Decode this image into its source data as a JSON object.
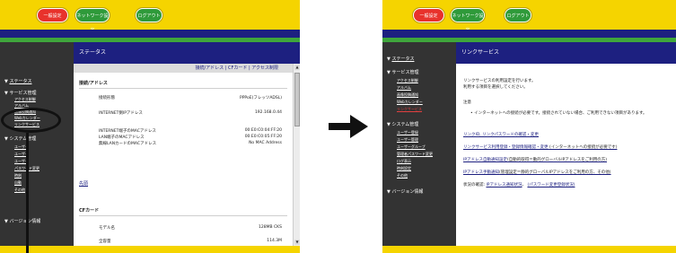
{
  "colors": {
    "header_yellow": "#f5d400",
    "nav_blue": "#1d2080",
    "accent_green": "#3fa63c",
    "sidebar_dark": "#333333",
    "button_red": "#e8322c",
    "button_green": "#2f9a3a",
    "link_blue": "#1d2080"
  },
  "left": {
    "top_buttons": [
      "一般設定",
      "ネットワーク設定",
      "ログアウト"
    ],
    "sidebar": {
      "status": "ステータス",
      "service_mgmt": "サービス管理",
      "service_items": [
        "アクセス制御",
        "アルバム",
        "画像投稿通知",
        "Webカレンダー"
      ],
      "highlighted": "リンクサービス",
      "system_mgmt": "システム管理",
      "system_items": [
        "ユーザー",
        "ユーザー",
        "ユーザー",
        "パスワード変更",
        "時刻",
        "自動",
        "その他"
      ],
      "version": "バージョン情報"
    },
    "title": "ステータス",
    "links_bar": "接続/アドレス | CFカード | アクセス制限",
    "section1": "接続/アドレス",
    "rows": [
      {
        "label": "接続形態",
        "value": "PPPoE(フレッツADSL)"
      },
      {
        "label": "INTERNET側IPアドレス",
        "value": "192.168.0.44"
      },
      {
        "label": "INTERNET端子のMACアドレス",
        "value": "00:E0:C0:04:FF:20"
      },
      {
        "label": "LAN端子のMACアドレス",
        "value": "00:E0:C0:05:FF:20"
      },
      {
        "label": "無線LANカードのMACアドレス",
        "value": "No MAC Address"
      }
    ],
    "top_link": "先頭",
    "section2": "CFカード",
    "cf_rows": [
      {
        "label": "モデル名",
        "value": "128MB CKS"
      },
      {
        "label": "全容量",
        "value": "114.3M"
      }
    ]
  },
  "right": {
    "top_buttons": [
      "一般設定",
      "ネットワーク設定",
      "ログアウト"
    ],
    "sidebar": {
      "status": "ステータス",
      "service_mgmt": "サービス管理",
      "service_items": [
        "アクセス制御",
        "アルバム",
        "画像投稿通知",
        "Webカレンダー"
      ],
      "highlighted": "リンクサービス",
      "system_mgmt": "システム管理",
      "system_items": [
        "ユーザー登録",
        "ユーザー管理",
        "ユーザーグループ",
        "管理者パスワード変更",
        "ログ表示",
        "時刻設定",
        "その他"
      ],
      "version": "バージョン情報"
    },
    "title": "リンクサービス",
    "intro_line1": "リンクサービスの利用設定を行います。",
    "intro_line2": "利用する項目を選択してください。",
    "note_label": "注意",
    "note_text": "インターネットへの接続が必要です。接続されていない場合、ご利用できない項目があります。",
    "links": [
      {
        "link": "リンクID, リンクパスワードの確認・変更",
        "rest": ""
      },
      {
        "link": "リンクサービス利用登録・登録情報確認・変更",
        "rest": "(インターネットへの接続が必要です)"
      },
      {
        "link": "IPアドレス自動通知設定",
        "rest": "(自動的取得＝動的グローバルIPアドレスをご利用の方)"
      },
      {
        "link": "IPアドレス手動通知",
        "rest": "(管理設定＝静的グローバルIPアドレスをご利用の方、その他)"
      }
    ],
    "status_prefix": "状況の確認:",
    "status_link1": "IPアドレス通知状況",
    "status_sep": "、",
    "status_link2": "(パスワード変更登録状況)"
  }
}
